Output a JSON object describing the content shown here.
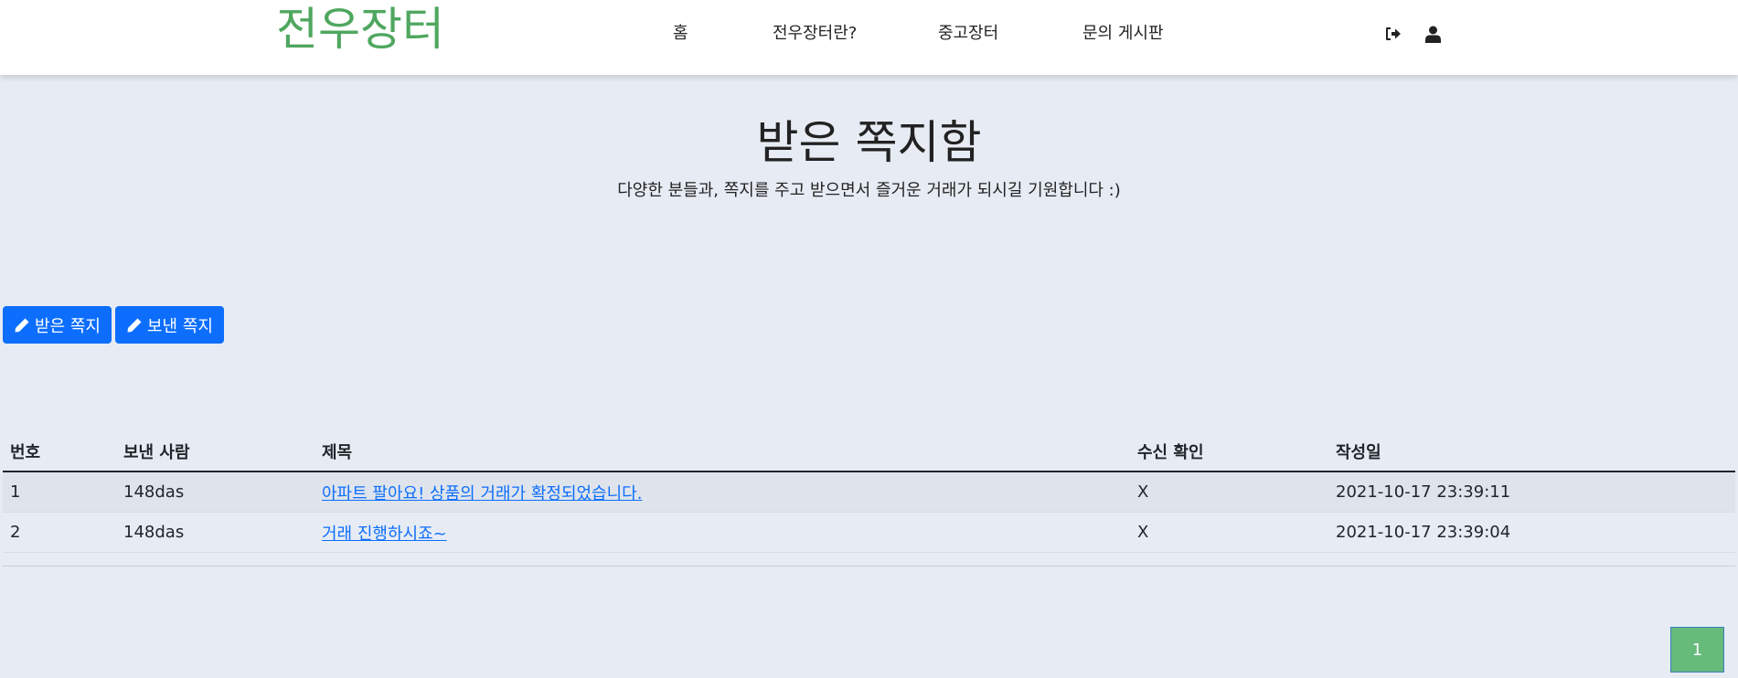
{
  "header": {
    "logo": "전우장터",
    "nav": [
      {
        "label": "홈"
      },
      {
        "label": "전우장터란?"
      },
      {
        "label": "중고장터"
      },
      {
        "label": "문의 게시판"
      }
    ],
    "icons": [
      "logout-icon",
      "user-icon"
    ]
  },
  "main": {
    "title": "받은 쪽지함",
    "subtitle": "다양한 분들과, 쪽지를 주고 받으면서 즐거운 거래가 되시길 기원합니다 :)",
    "buttons": {
      "received": "받은 쪽지",
      "sent": "보낸 쪽지"
    },
    "table": {
      "headers": [
        "번호",
        "보낸 사람",
        "제목",
        "수신 확인",
        "작성일"
      ],
      "rows": [
        {
          "no": "1",
          "sender": "148das",
          "subject": "아파트 팔아요! 상품의 거래가 확정되었습니다.",
          "read": "X",
          "date": "2021-10-17 23:39:11"
        },
        {
          "no": "2",
          "sender": "148das",
          "subject": "거래 진행하시죠~",
          "read": "X",
          "date": "2021-10-17 23:39:04"
        }
      ]
    },
    "pagination": {
      "current": "1"
    }
  },
  "colors": {
    "brand": "#4fa75f",
    "primary": "#0d6efd",
    "background": "#e7ecf4",
    "pagination": "#66bb7b"
  }
}
